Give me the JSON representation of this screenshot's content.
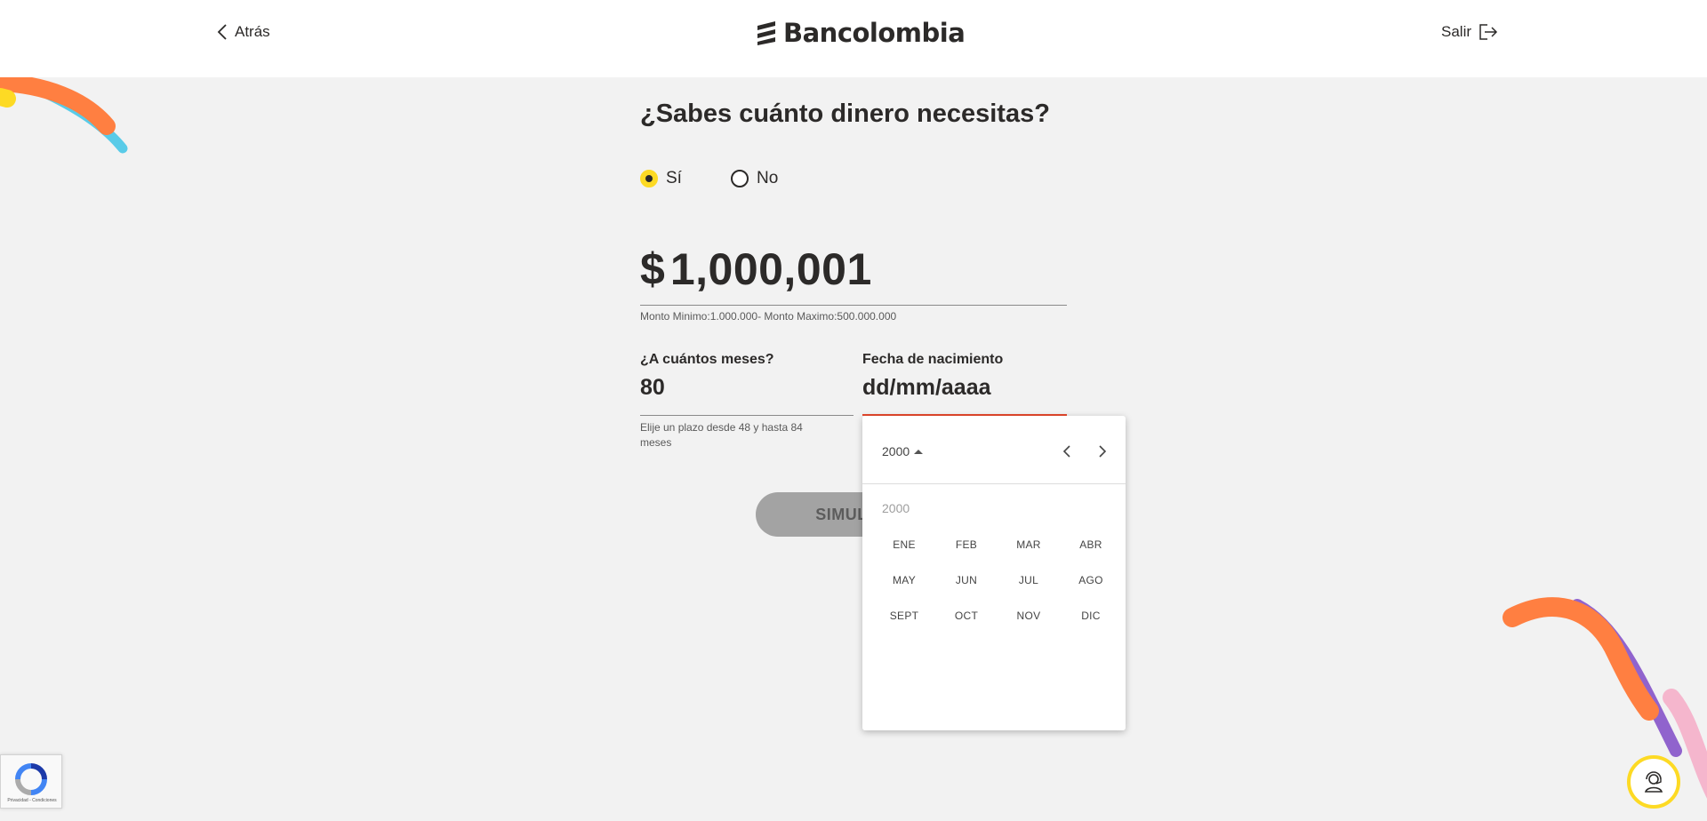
{
  "header": {
    "back_label": "Atrás",
    "brand": "Bancolombia",
    "exit_label": "Salir"
  },
  "form": {
    "title": "¿Sabes cuánto dinero necesitas?",
    "radio_yes": "Sí",
    "radio_no": "No",
    "selected": "yes",
    "currency": "$",
    "amount": "1,000,001",
    "amount_hint": "Monto Minimo:1.000.000- Monto Maximo:500.000.000",
    "months_label": "¿A cuántos meses?",
    "months_value": "80",
    "months_hint": "Elije un plazo desde 48 y hasta 84 meses",
    "birth_label": "Fecha de nacimiento",
    "birth_value": "dd/mm/aaaa",
    "simulate_label": "SIMULAR"
  },
  "datepicker": {
    "year_toggle": "2000",
    "year_label": "2000",
    "months": [
      "ENE",
      "FEB",
      "MAR",
      "ABR",
      "MAY",
      "JUN",
      "JUL",
      "AGO",
      "SEPT",
      "OCT",
      "NOV",
      "DIC"
    ]
  },
  "recaptcha": {
    "footer": "Privacidad - Condiciones"
  },
  "colors": {
    "accent_yellow": "#fdda24",
    "orange": "#ff7f41",
    "blue": "#59cbe8",
    "purple": "#9063cd",
    "pink": "#f5b6cd",
    "error_underline": "#e5472c"
  },
  "icons": {
    "back": "chevron-left-icon",
    "exit": "exit-icon",
    "prev": "chevron-left-icon",
    "next": "chevron-right-icon",
    "help": "support-agent-icon",
    "recaptcha": "recaptcha-icon"
  }
}
